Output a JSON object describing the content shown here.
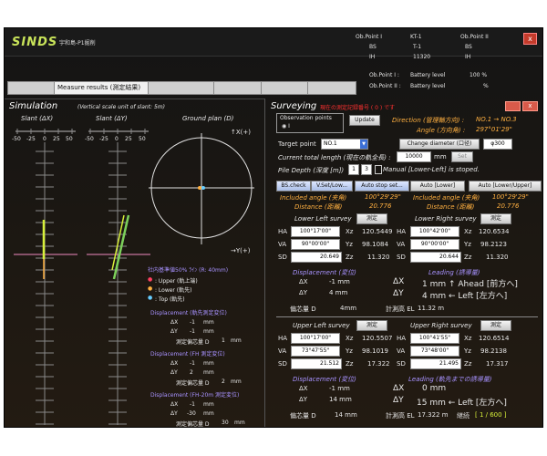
{
  "header": {
    "logo": "SINDS",
    "subtitle": "宇和島-P1掘削",
    "close": "x",
    "ob1_label": "Ob.Point I",
    "ob1_id": "KT-1",
    "ob2_label": "Ob.Point II",
    "bs_label": "BS",
    "bs1": "T-1",
    "bs2": "BS",
    "ih_label": "IH",
    "ih1": "11320",
    "ih2": "IH",
    "battery1_label": "Ob.Point I :",
    "battery1_text": "Battery level",
    "battery1_value": "100 %",
    "battery2_label": "Ob.Point II :",
    "battery2_text": "Battery level",
    "battery2_value": "%"
  },
  "tabs": [
    "",
    "Measure results (測定結果)",
    "",
    "",
    "",
    ""
  ],
  "simulation": {
    "title": "Simulation",
    "vscale": "(Vertical scale unit of slant: 5m)",
    "slant_x": "Slant (ΔX)",
    "slant_y": "Slant (ΔY)",
    "ground_plan": "Ground plan (D)",
    "x_axis_ticks": [
      "-50",
      "-25",
      "0",
      "25",
      "50"
    ],
    "y_axis_ticks": [
      "-50",
      "-25",
      "0",
      "25",
      "50"
    ],
    "xplus": "↑X(+)",
    "yplus": "→Y(+)",
    "note": "社内基準値50% ﾗｲﾝ (R: 40mm)",
    "legend": [
      {
        "mark": "●",
        "text": ": Upper (軌上端)",
        "color": "#ff4060"
      },
      {
        "mark": "●",
        "text": ": Lower (軌先)",
        "color": "#ffb040"
      },
      {
        "mark": "●",
        "text": ": Top (軌先)",
        "color": "#66ccff"
      }
    ],
    "disp_blocks": [
      {
        "title": "Displacement (軌先測定変位)",
        "dx_label": "ΔX",
        "dx_val": "-1",
        "dx_unit": "mm",
        "dy_label": "ΔY",
        "dy_val": "-1",
        "dy_unit": "mm",
        "d_label": "測定偏芯量 D",
        "d_val": "1",
        "d_unit": "mm"
      },
      {
        "title": "Displacement (FH 測定変位)",
        "dx_label": "ΔX",
        "dx_val": "-1",
        "dx_unit": "mm",
        "dy_label": "ΔY",
        "dy_val": "2",
        "dy_unit": "mm",
        "d_label": "測定偏芯量 D",
        "d_val": "2",
        "d_unit": "mm"
      },
      {
        "title": "Displacement (FH-20m 測定変位)",
        "dx_label": "ΔX",
        "dx_val": "-1",
        "dx_unit": "mm",
        "dy_label": "ΔY",
        "dy_val": "-30",
        "dy_unit": "mm",
        "d_label": "測定偏芯量 D",
        "d_val": "30",
        "d_unit": "mm"
      }
    ]
  },
  "surveying": {
    "title": "Surveying",
    "subtitle": "現在の測定記録番号 ( 0 ) です",
    "obs_points": "Observation points",
    "obs_radio": "I",
    "update": "Update",
    "direction_label": "Direction (管理軸方向) :",
    "direction_val": "NO.1 → NO.3",
    "angle_label": "Angle (方向角) :",
    "angle_val": "297°01'29\"",
    "target_label": "Target point",
    "target_val": "NO.1",
    "change_diam": "Change diameter (口径)",
    "diam_val": "φ300",
    "total_len_label": "Current total length (現在の軌全長) :",
    "total_len_val": "10000",
    "total_len_unit": "mm",
    "set_btn": "Set",
    "pile_depth_label": "Pile Depth (深度 [m])",
    "pile_a": "1",
    "pile_b": "3",
    "manual": "Manual [Lower-Left] is stoped.",
    "btn_bscheck": "BS.check",
    "btn_vset": "V.Set/Low...",
    "btn_autostop": "Auto stop set...",
    "btn_autolower": "Auto [Lower]",
    "btn_autolu": "Auto [Lower/Upper]",
    "incl_label": "Included angle (夹角)",
    "incl_val": "100°29'29\"",
    "incl_label2": "Included angle (夹角)",
    "incl_val2": "100°29'29\"",
    "dist_label": "Distance (距離)",
    "dist_val": "20.776",
    "dist_label2": "Distance (距離)",
    "dist_val2": "20.776",
    "lower": {
      "left_title": "Lower Left survey",
      "right_title": "Lower Right survey",
      "measure": "測定",
      "ha_l": "100°17'00\"",
      "xz_l": "120.5449",
      "va_l": "90°00'00\"",
      "yz_l": "98.1084",
      "sd_l": "20.649",
      "zz_l": "11.320",
      "ha_r": "100°42'00\"",
      "xz_r": "120.6534",
      "va_r": "90°00'00\"",
      "yz_r": "98.2123",
      "sd_r": "20.644",
      "zz_r": "11.320",
      "disp_title": "Displacement (変位)",
      "dx": "-1 mm",
      "dy": "4 mm",
      "lead_title": "Leading (誘導量)",
      "lead_x": "1 mm ↑ Ahead [前方へ]",
      "lead_y": "4 mm ← Left [左方へ]",
      "d_label": "偏芯量 D",
      "d_val": "4mm",
      "el_label": "計測高 EL",
      "el_val": "11.32 m"
    },
    "upper": {
      "left_title": "Upper Left survey",
      "right_title": "Upper Right survey",
      "measure": "測定",
      "ha_l": "100°17'00\"",
      "xz_l": "120.5507",
      "va_l": "73°47'55\"",
      "yz_l": "98.1019",
      "sd_l": "21.512",
      "zz_l": "17.322",
      "ha_r": "100°41'55\"",
      "xz_r": "120.6514",
      "va_r": "73°48'00\"",
      "yz_r": "98.2138",
      "sd_r": "21.495",
      "zz_r": "17.317",
      "disp_title": "Displacement (変位)",
      "dx": "-1 mm",
      "dy": "14 mm",
      "lead_title": "Leading (軌先までの誘導量)",
      "lead_x": "0 mm",
      "lead_y": "15 mm ← Left [左方へ]",
      "d_label": "偏芯量 D",
      "d_val": "14 mm",
      "el_label": "計測高 EL",
      "el_val": "17.322 m",
      "count_label": "継続",
      "count_val": "[ 1 / 600 ]"
    },
    "labels": {
      "ha": "HA",
      "va": "VA",
      "sd": "SD",
      "xz": "Xz",
      "yz": "Yz",
      "zz": "Zz",
      "dx": "ΔX",
      "dy": "ΔY"
    }
  }
}
